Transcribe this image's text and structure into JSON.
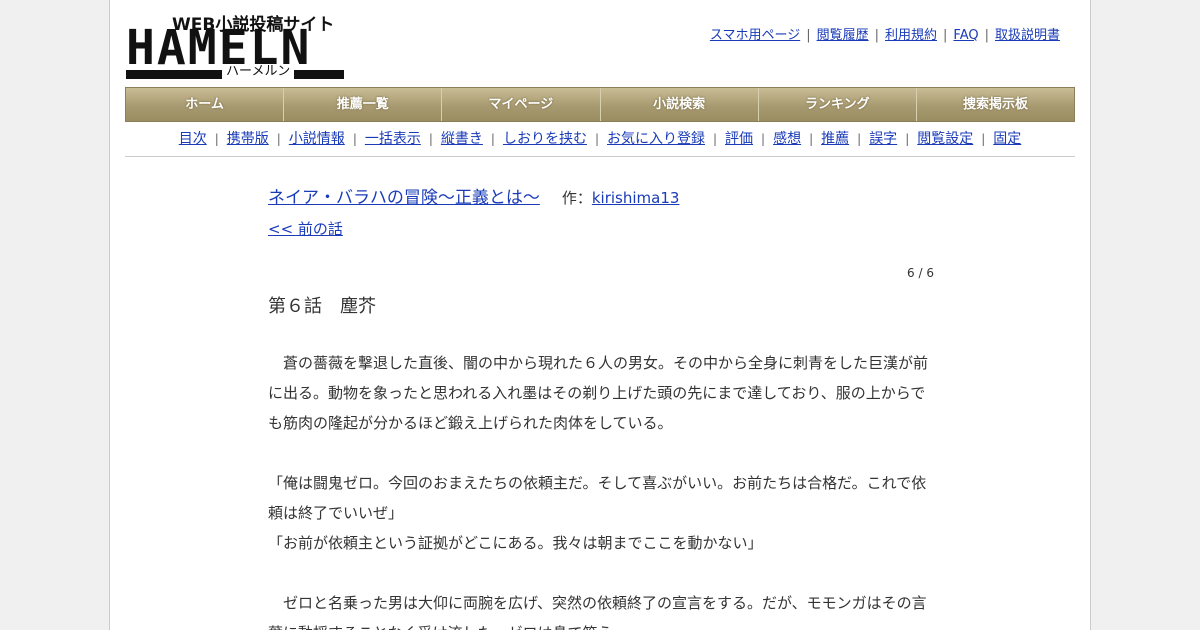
{
  "logo": {
    "tagline": "WEB小説投稿サイト",
    "wordmark": "HAMELN",
    "kana": "ハーメルン"
  },
  "top_links": [
    "スマホ用ページ",
    "閲覧履歴",
    "利用規約",
    "FAQ",
    "取扱説明書"
  ],
  "nav": [
    "ホーム",
    "推薦一覧",
    "マイページ",
    "小説検索",
    "ランキング",
    "捜索掲示板"
  ],
  "subnav": [
    "目次",
    "携帯版",
    "小説情報",
    "一括表示",
    "縦書き",
    "しおりを挟む",
    "お気に入り登録",
    "評価",
    "感想",
    "推薦",
    "誤字",
    "閲覧設定",
    "固定"
  ],
  "separator": "|",
  "novel": {
    "title": "ネイア・バラハの冒険～正義とは～",
    "author_label": "作：",
    "author": "kirishima13",
    "prev_link": "<< 前の話",
    "page_count": "6 / 6",
    "chapter_title": "第６話　塵芥"
  },
  "paragraphs": [
    "　蒼の薔薇を撃退した直後、闇の中から現れた６人の男女。その中から全身に刺青をした巨漢が前に出る。動物を象ったと思われる入れ墨はその剃り上げた頭の先にまで達しており、服の上からでも筋肉の隆起が分かるほど鍛え上げられた肉体をしている。",
    "",
    "「俺は闘鬼ゼロ。今回のおまえたちの依頼主だ。そして喜ぶがいい。お前たちは合格だ。これで依頼は終了でいいぜ」",
    "「お前が依頼主という証拠がどこにある。我々は朝までここを動かない」",
    "",
    "　ゼロと名乗った男は大仰に両腕を広げ、突然の依頼終了の宣言をする。だが、モモンガはその言葉に動揺することなく受け流した。ゼロは鼻で笑う。"
  ]
}
